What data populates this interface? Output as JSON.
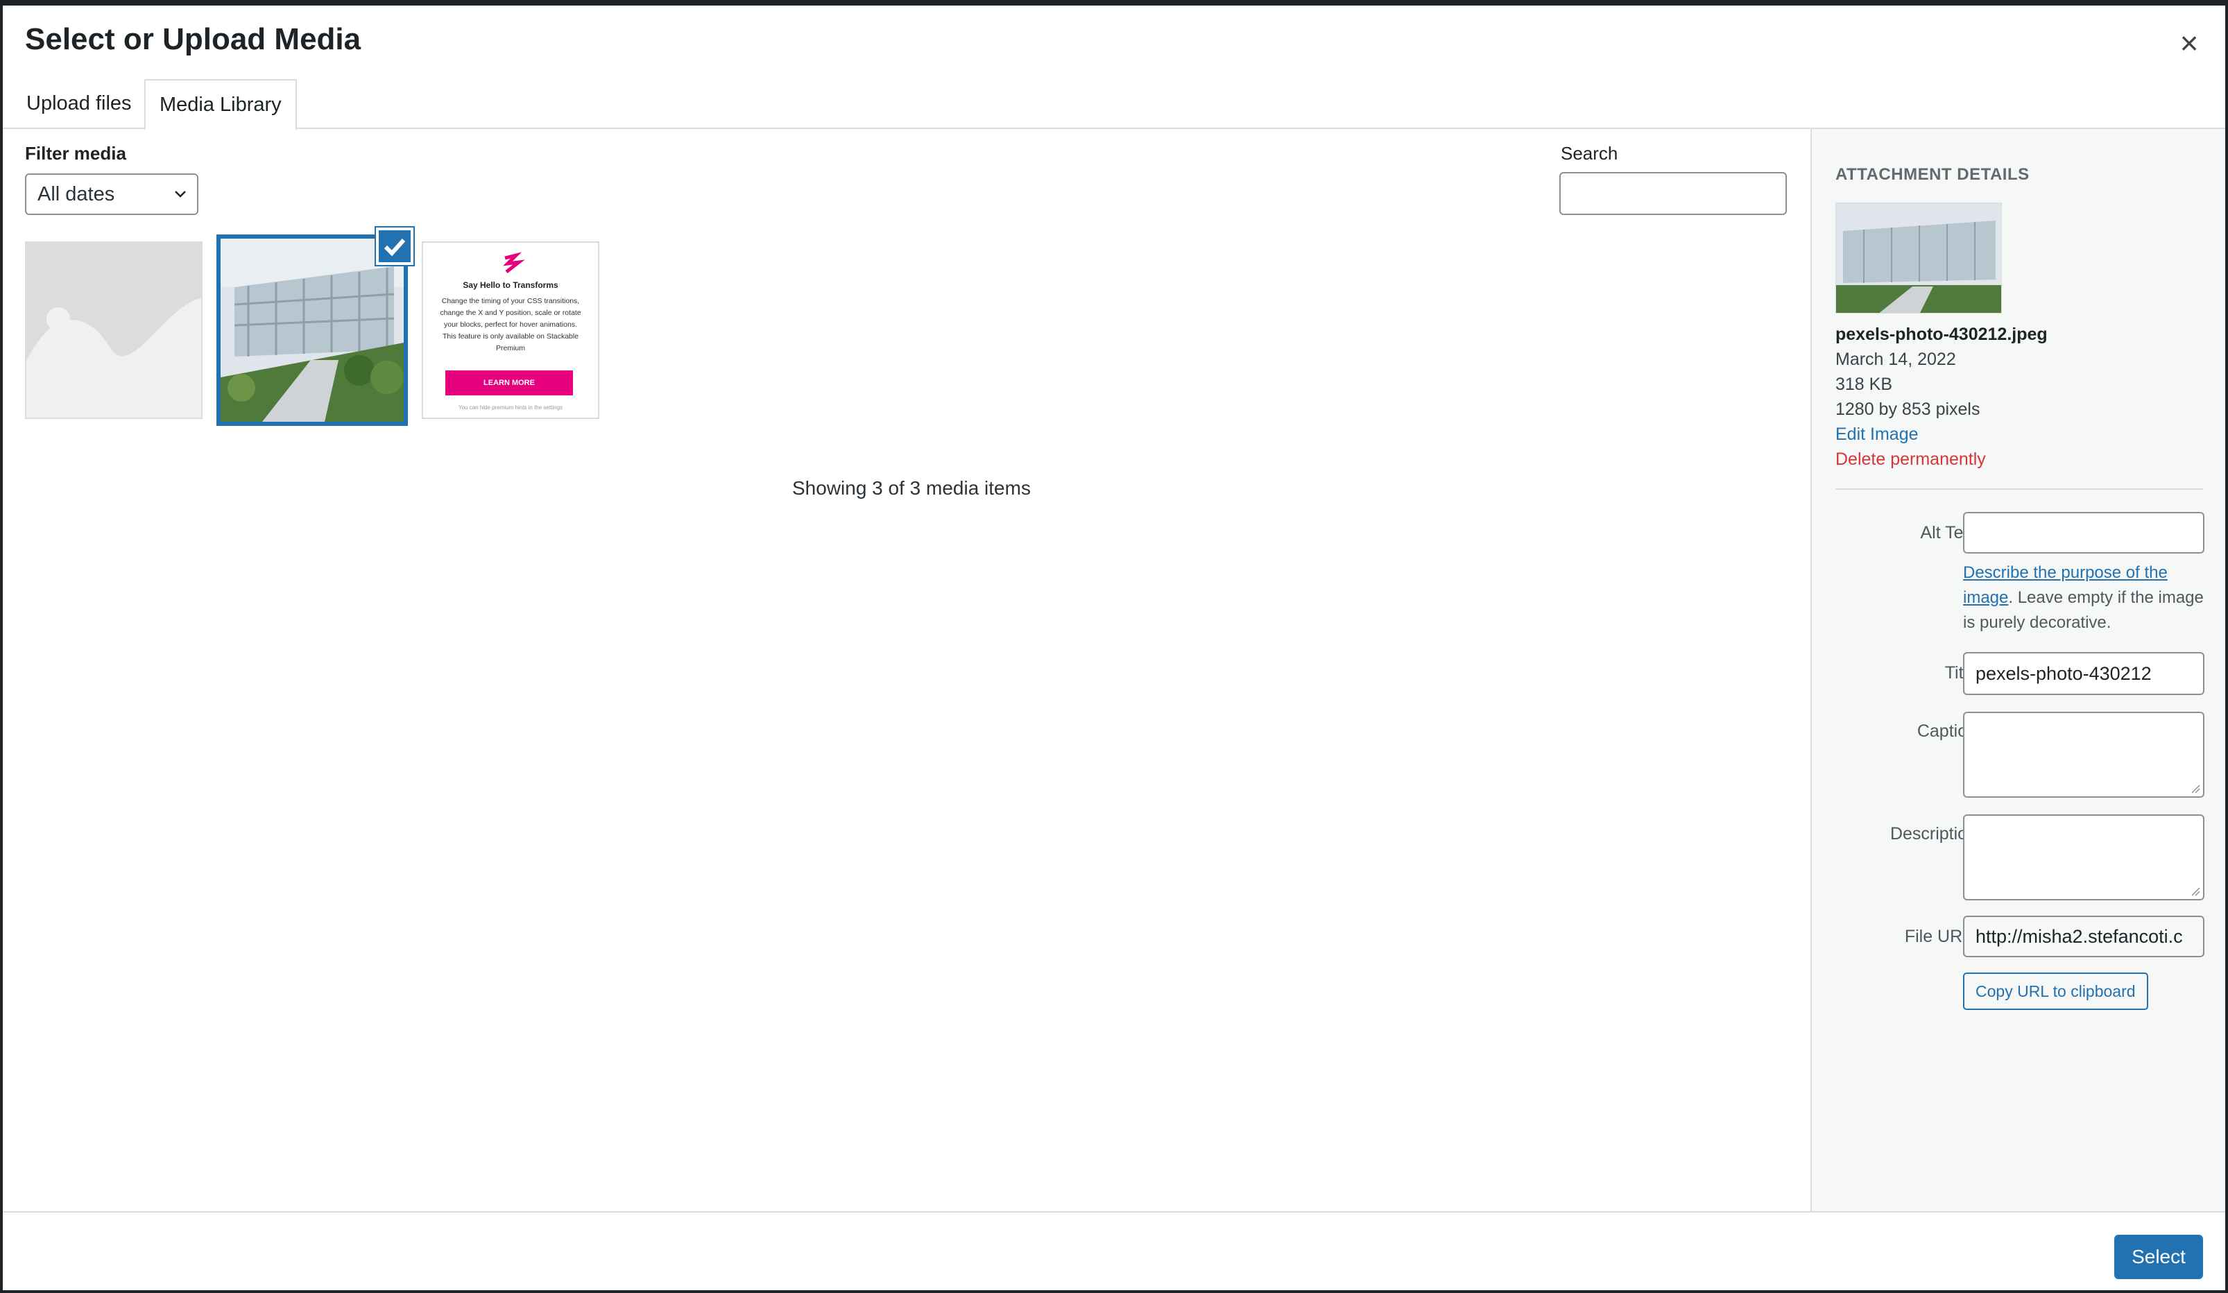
{
  "modal": {
    "title": "Select or Upload Media",
    "close_label": "×"
  },
  "tabs": [
    {
      "label": "Upload files"
    },
    {
      "label": "Media Library"
    }
  ],
  "filter": {
    "label": "Filter media",
    "date_selected": "All dates"
  },
  "search": {
    "label": "Search",
    "value": ""
  },
  "grid": {
    "items": [
      {
        "kind": "placeholder-image"
      },
      {
        "kind": "photo",
        "selected": true
      },
      {
        "kind": "promo-graphic",
        "heading": "Say Hello to Transforms",
        "body": "Change the timing of your CSS transitions, change the X and Y position, scale or rotate your blocks, perfect for hover animations. This feature is only available on Stackable Premium",
        "button": "LEARN MORE",
        "footnote": "You can hide premium hints in the settings"
      }
    ],
    "count_text": "Showing 3 of 3 media items"
  },
  "details": {
    "heading": "ATTACHMENT DETAILS",
    "filename": "pexels-photo-430212.jpeg",
    "date": "March 14, 2022",
    "size": "318 KB",
    "dimensions": "1280 by 853 pixels",
    "edit_link": "Edit Image",
    "delete_link": "Delete permanently",
    "alt_label": "Alt Text",
    "alt_value": "",
    "alt_help_link": "Describe the purpose of the image",
    "alt_help_rest": ". Leave empty if the image is purely decorative.",
    "title_label": "Title",
    "title_value": "pexels-photo-430212",
    "caption_label": "Caption",
    "caption_value": "",
    "description_label": "Description",
    "description_value": "",
    "url_label": "File URL:",
    "url_value": "http://misha2.stefancoti.c",
    "copy_button": "Copy URL to clipboard"
  },
  "footer": {
    "select_button": "Select"
  },
  "colors": {
    "accent": "#2271b1",
    "danger": "#d63638",
    "promo_button": "#e6007e"
  }
}
